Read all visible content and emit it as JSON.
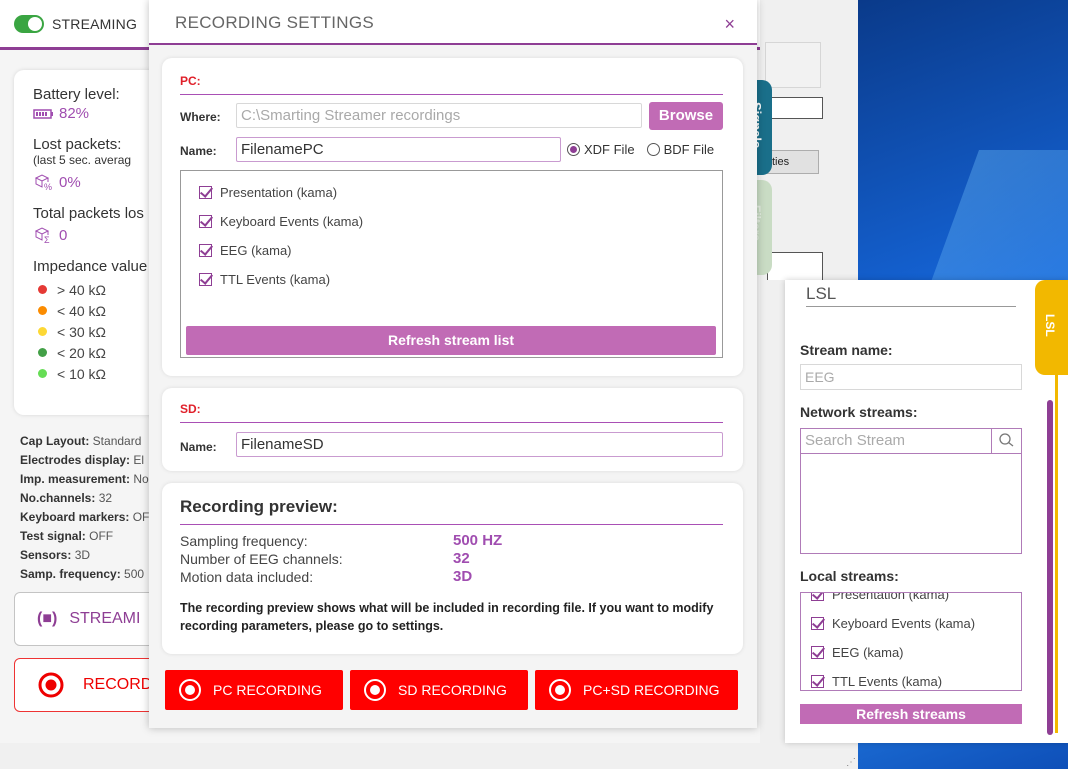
{
  "app": {
    "streaming_toggle_label": "STREAMING",
    "battery_label": "Battery level:",
    "battery_value": "82%",
    "lost_packets_label": "Lost packets:",
    "lost_packets_sub": "(last 5 sec. averag",
    "lost_packets_value": "0%",
    "total_lost_label": "Total packets los",
    "total_lost_value": "0",
    "impedance_label": "Impedance value",
    "impedance_levels": [
      {
        "label": "> 40 kΩ",
        "color": "#e53935"
      },
      {
        "label": "< 40 kΩ",
        "color": "#fb8c00"
      },
      {
        "label": "< 30 kΩ",
        "color": "#fdd835"
      },
      {
        "label": "< 20 kΩ",
        "color": "#43a047"
      },
      {
        "label": "< 10 kΩ",
        "color": "#66dd55"
      }
    ],
    "info": [
      {
        "k": "Cap Layout:",
        "v": " Standard"
      },
      {
        "k": "Electrodes display:",
        "v": " El"
      },
      {
        "k": "Imp. measurement:",
        "v": " No"
      },
      {
        "k": "No.channels:",
        "v": " 32"
      },
      {
        "k": "Keyboard markers:",
        "v": " OF"
      },
      {
        "k": "Test signal:",
        "v": " OFF"
      },
      {
        "k": "Sensors:",
        "v": " 3D"
      },
      {
        "k": "Samp. frequency:",
        "v": " 500"
      }
    ],
    "stream_button": "STREAMI",
    "stream_button_icon": "(■)",
    "record_button": "RECORD",
    "tab_signals": "Signals",
    "tab_filters": "Filters"
  },
  "background_window": {
    "button_text": "ties"
  },
  "modal": {
    "title": "RECORDING SETTINGS",
    "close": "×",
    "pc": {
      "label": "PC:",
      "where_label": "Where:",
      "where_value": "C:\\Smarting Streamer recordings",
      "browse": "Browse",
      "name_label": "Name:",
      "name_value": "FilenamePC",
      "xdf_label": "XDF File",
      "bdf_label": "BDF File",
      "streams": [
        "Presentation (kama)",
        "Keyboard Events (kama)",
        "EEG (kama)",
        "TTL Events (kama)"
      ],
      "refresh": "Refresh stream list"
    },
    "sd": {
      "label": "SD:",
      "name_label": "Name:",
      "name_value": "FilenameSD"
    },
    "preview": {
      "title": "Recording preview:",
      "rows": [
        {
          "k": "Sampling frequency:",
          "v": "500 HZ"
        },
        {
          "k": "Number of EEG channels:",
          "v": "32"
        },
        {
          "k": "Motion data included:",
          "v": "3D"
        }
      ],
      "note": "The recording preview shows what will be included in recording file. If you want to modify recording parameters, please go to settings."
    },
    "buttons": {
      "pc": "PC RECORDING",
      "sd": "SD RECORDING",
      "pcsd": "PC+SD RECORDING"
    }
  },
  "lsl": {
    "title": "LSL",
    "tab": "LSL",
    "stream_name_label": "Stream name:",
    "stream_name_placeholder": "EEG",
    "network_label": "Network streams:",
    "search_placeholder": "Search Stream",
    "local_label": "Local streams:",
    "local_streams": [
      "Presentation (kama)",
      "Keyboard Events (kama)",
      "EEG (kama)",
      "TTL Events (kama)"
    ],
    "refresh": "Refresh streams"
  }
}
